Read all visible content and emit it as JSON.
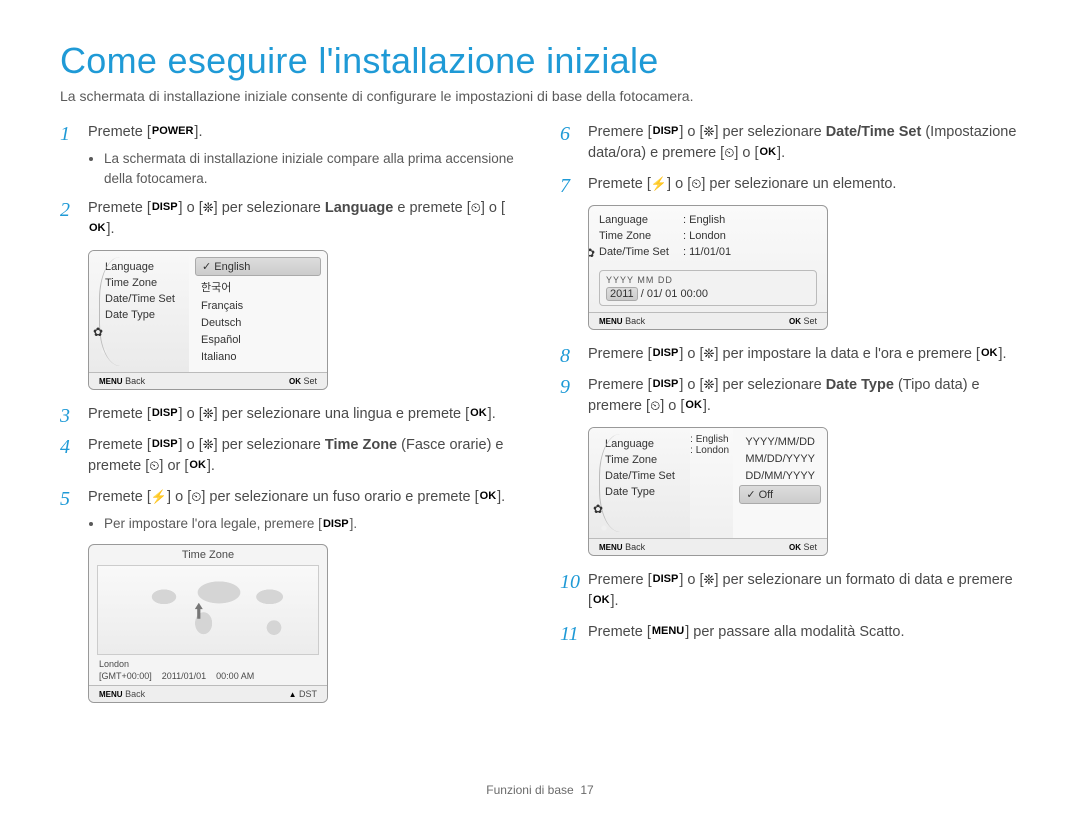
{
  "title": "Come eseguire l'installazione iniziale",
  "subtitle": "La schermata di installazione iniziale consente di configurare le impostazioni di base della fotocamera.",
  "buttons": {
    "power": "POWER",
    "disp": "DISP",
    "ok": "OK",
    "menu": "MENU",
    "macro": "❊",
    "timer": "⏲",
    "flash": "⚡"
  },
  "steps_left": {
    "s1": {
      "num": "1",
      "pre": "Premete [",
      "post": "]."
    },
    "s1_sub": "La schermata di installazione iniziale compare alla prima accensione della fotocamera.",
    "s2": {
      "num": "2",
      "a": "Premete [",
      "b": "] o [",
      "c": "] per selezionare ",
      "lang": "Language",
      "d": " e premete [",
      "e": "] o [",
      "f": "]."
    },
    "s3": {
      "num": "3",
      "a": "Premete [",
      "b": "] o [",
      "c": "] per selezionare una lingua e premete [",
      "d": "]."
    },
    "s4": {
      "num": "4",
      "a": "Premete [",
      "b": "] o [",
      "c": "] per selezionare ",
      "tz": "Time Zone",
      "d": " (Fasce orarie) e premete [",
      "e": "] or [",
      "f": "]."
    },
    "s5": {
      "num": "5",
      "a": "Premete [",
      "b": "] o [",
      "c": "] per selezionare un fuso orario e premete [",
      "d": "]."
    },
    "s5_sub": "Per impostare l'ora legale, premere [",
    "s5_sub_end": "]."
  },
  "steps_right": {
    "s6": {
      "num": "6",
      "a": "Premere [",
      "b": "] o [",
      "c": "] per selezionare ",
      "dts": "Date/Time Set",
      "d": " (Impostazione data/ora) e premere [",
      "e": "] o [",
      "f": "]."
    },
    "s7": {
      "num": "7",
      "a": "Premete [",
      "b": "] o [",
      "c": "] per selezionare un elemento."
    },
    "s8": {
      "num": "8",
      "a": "Premere [",
      "b": "] o [",
      "c": "] per impostare la data e l'ora e premere [",
      "d": "]."
    },
    "s9": {
      "num": "9",
      "a": "Premere [",
      "b": "] o [",
      "c": "] per selezionare ",
      "dt": "Date Type",
      "d": " (Tipo data) e premere [",
      "e": "] o [",
      "f": "]."
    },
    "s10": {
      "num": "10",
      "a": "Premere [",
      "b": "] o [",
      "c": "] per selezionare un formato di data e premere [",
      "d": "]."
    },
    "s11": {
      "num": "11",
      "a": "Premete [",
      "b": "] per passare alla modalità Scatto."
    }
  },
  "ss1": {
    "left": [
      "Language",
      "Time Zone",
      "Date/Time Set",
      "Date Type"
    ],
    "right": [
      "English",
      "한국어",
      "Français",
      "Deutsch",
      "Español",
      "Italiano"
    ],
    "selected": 0,
    "footer_back_label": "MENU",
    "footer_back": "Back",
    "footer_set_label": "OK",
    "footer_set": "Set"
  },
  "ss_tz": {
    "title": "Time Zone",
    "city": "London",
    "gmt": "[GMT+00:00]",
    "date": "2011/01/01",
    "time": "00:00 AM",
    "footer_back_label": "MENU",
    "footer_back": "Back",
    "footer_dst_label": "▲",
    "footer_dst": "DST"
  },
  "ss2": {
    "labels": [
      "Language",
      "Time Zone",
      "Date/Time Set"
    ],
    "values": [
      ": English",
      ": London",
      ": 11/01/01"
    ],
    "date_hdr": "YYYY MM DD",
    "date_year": "2011",
    "date_rest": "/ 01/ 01  00:00",
    "footer_back_label": "MENU",
    "footer_back": "Back",
    "footer_set_label": "OK",
    "footer_set": "Set"
  },
  "ss3": {
    "labels": [
      "Language",
      "Time Zone",
      "Date/Time Set",
      "Date Type"
    ],
    "values": [
      ": English",
      ": London",
      "",
      ""
    ],
    "options": [
      "YYYY/MM/DD",
      "MM/DD/YYYY",
      "DD/MM/YYYY",
      "Off"
    ],
    "selected": 3,
    "footer_back_label": "MENU",
    "footer_back": "Back",
    "footer_set_label": "OK",
    "footer_set": "Set"
  },
  "footer": {
    "section": "Funzioni di base",
    "page": "17"
  }
}
